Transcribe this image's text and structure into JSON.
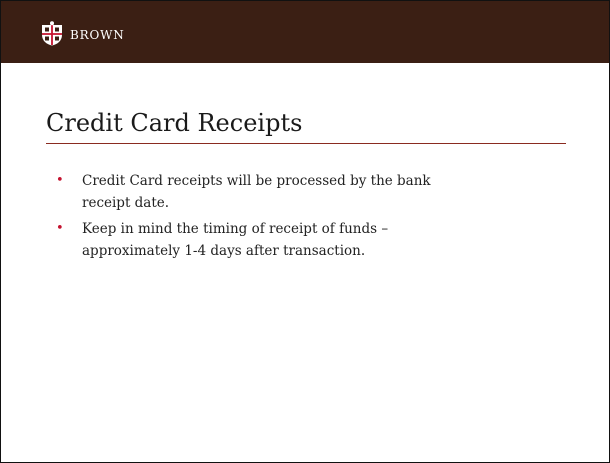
{
  "header": {
    "brand_name": "BROWN",
    "logo_icon": "brown-shield-icon",
    "bar_color": "#3b1f14",
    "shield_color": "#c4122f"
  },
  "slide": {
    "title": "Credit Card Receipts",
    "rule_color": "#8a2b20",
    "bullet_color": "#c4122f",
    "bullets": [
      {
        "lines": [
          "Credit Card receipts will be processed by the bank",
          "receipt date."
        ]
      },
      {
        "lines": [
          "Keep in mind the timing of receipt of funds –",
          "approximately 1-4 days after transaction."
        ]
      }
    ]
  }
}
